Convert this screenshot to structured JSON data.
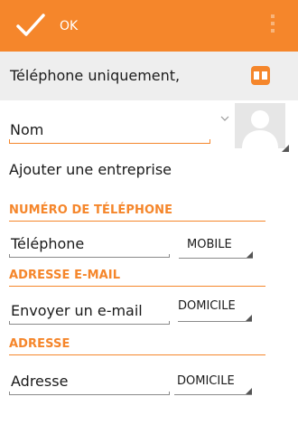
{
  "colors": {
    "accent": "#f5862b",
    "toolbar_text": "#ffffff",
    "account_bar": "#eeeeee"
  },
  "toolbar": {
    "ok_label": "OK",
    "ok_icon": "checkmark-icon",
    "menu_icon": "overflow-menu-icon"
  },
  "account": {
    "label": "Téléphone uniquement,",
    "icon": "contacts-book-icon"
  },
  "name_field": {
    "placeholder": "Nom",
    "expand_icon": "chevron-down-icon",
    "photo_icon": "contact-photo-placeholder"
  },
  "add_company": "Ajouter une entreprise",
  "sections": {
    "phone": {
      "header": "NUMÉRO DE TÉLÉPHONE",
      "placeholder": "Téléphone",
      "type": "MOBILE"
    },
    "email": {
      "header": "ADRESSE E-MAIL",
      "placeholder": "Envoyer un e-mail",
      "type": "DOMICILE"
    },
    "address": {
      "header": "ADRESSE",
      "placeholder": "Adresse",
      "type": "DOMICILE"
    }
  }
}
